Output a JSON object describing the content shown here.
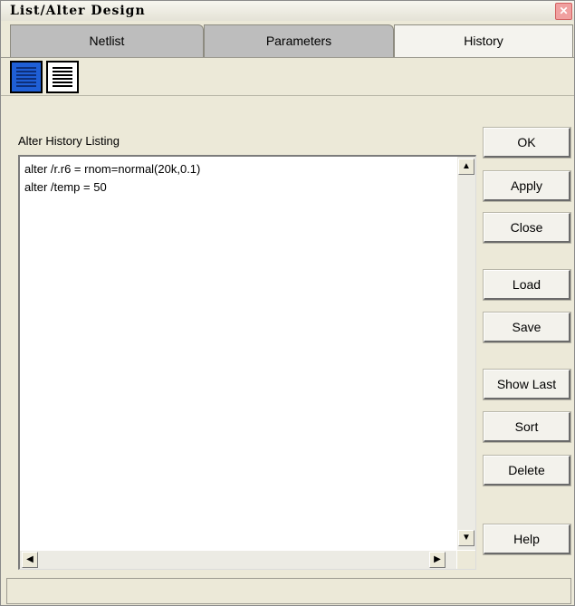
{
  "window": {
    "title": "List/Alter Design",
    "close_icon": "close-icon"
  },
  "tabs": [
    {
      "label": "Netlist",
      "state": "inactive"
    },
    {
      "label": "Parameters",
      "state": "inactive"
    },
    {
      "label": "History",
      "state": "active"
    }
  ],
  "toolbar": {
    "list_view_blue": "list-view-icon",
    "list_view_plain": "list-view-icon",
    "blue_color": "#1f5fd6"
  },
  "listing": {
    "label": "Alter History Listing",
    "lines": [
      "alter /r.r6 = rnom=normal(20k,0.1)",
      "alter /temp = 50"
    ]
  },
  "buttons": {
    "ok": "OK",
    "apply": "Apply",
    "close": "Close",
    "load": "Load",
    "save": "Save",
    "show_last": "Show Last",
    "sort": "Sort",
    "delete": "Delete",
    "help": "Help"
  },
  "scroll_icons": {
    "up": "▲",
    "down": "▼",
    "left": "◀",
    "right": "▶"
  }
}
